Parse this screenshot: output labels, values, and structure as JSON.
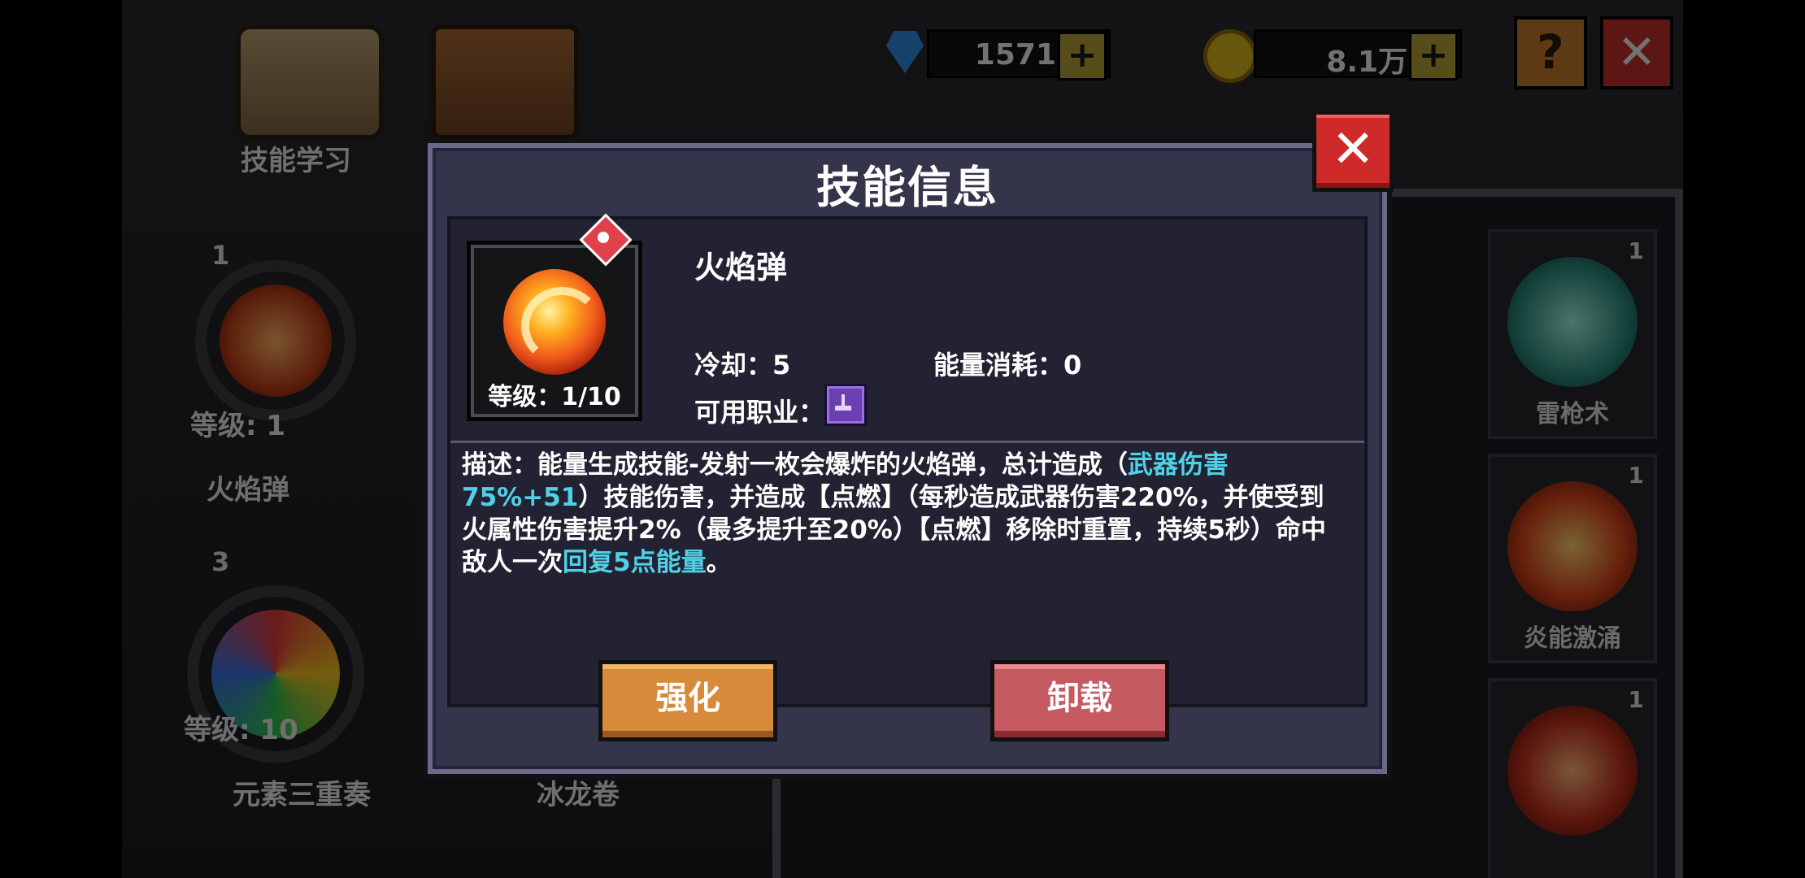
{
  "hud": {
    "gems": "1571",
    "gold": "8.1万",
    "plus_symbol": "+",
    "help_symbol": "?",
    "close_symbol": "✕"
  },
  "background": {
    "menu_skill_learn": "技能学习",
    "equipped": [
      {
        "name": "火焰弹",
        "level": "等级: 1",
        "slot": "1"
      },
      {
        "name": "元素三重奏",
        "level": "等级: 10",
        "slot": "3"
      },
      {
        "name": "冰龙卷"
      }
    ],
    "grid": [
      {
        "name": "雷枪术",
        "count": "1"
      },
      {
        "name": "炎能激涌",
        "count": "1"
      },
      {
        "name": "",
        "count": "1"
      }
    ]
  },
  "modal": {
    "title": "技能信息",
    "close_symbol": "✕",
    "skill_name": "火焰弹",
    "level": "等级：1/10",
    "cooldown": "冷却：5",
    "energy_cost": "能量消耗：0",
    "classes_label": "可用职业：",
    "description": {
      "p1": "描述：能量生成技能-发射一枚会爆炸的火焰弹，总计造成（",
      "h1": "武器伤害75%+51",
      "p2": "）技能伤害，并造成【点燃】（每秒造成武器伤害220%，并使受到火属性伤害提升2%（最多提升至20%）【点燃】移除时重置，持续5秒）命中敌人一次",
      "h2": "回复5点能量",
      "p3": "。"
    },
    "upgrade_label": "强化",
    "unload_label": "卸载"
  },
  "colors": {
    "highlight": "#4fd2e8",
    "upgrade": "#d68a3a",
    "unload": "#c55a60",
    "close": "#cf2a2a"
  },
  "icons": [
    "gem-icon",
    "coin-icon",
    "fireball-icon",
    "fire-element-icon",
    "mage-class-icon",
    "close-icon",
    "help-icon"
  ]
}
